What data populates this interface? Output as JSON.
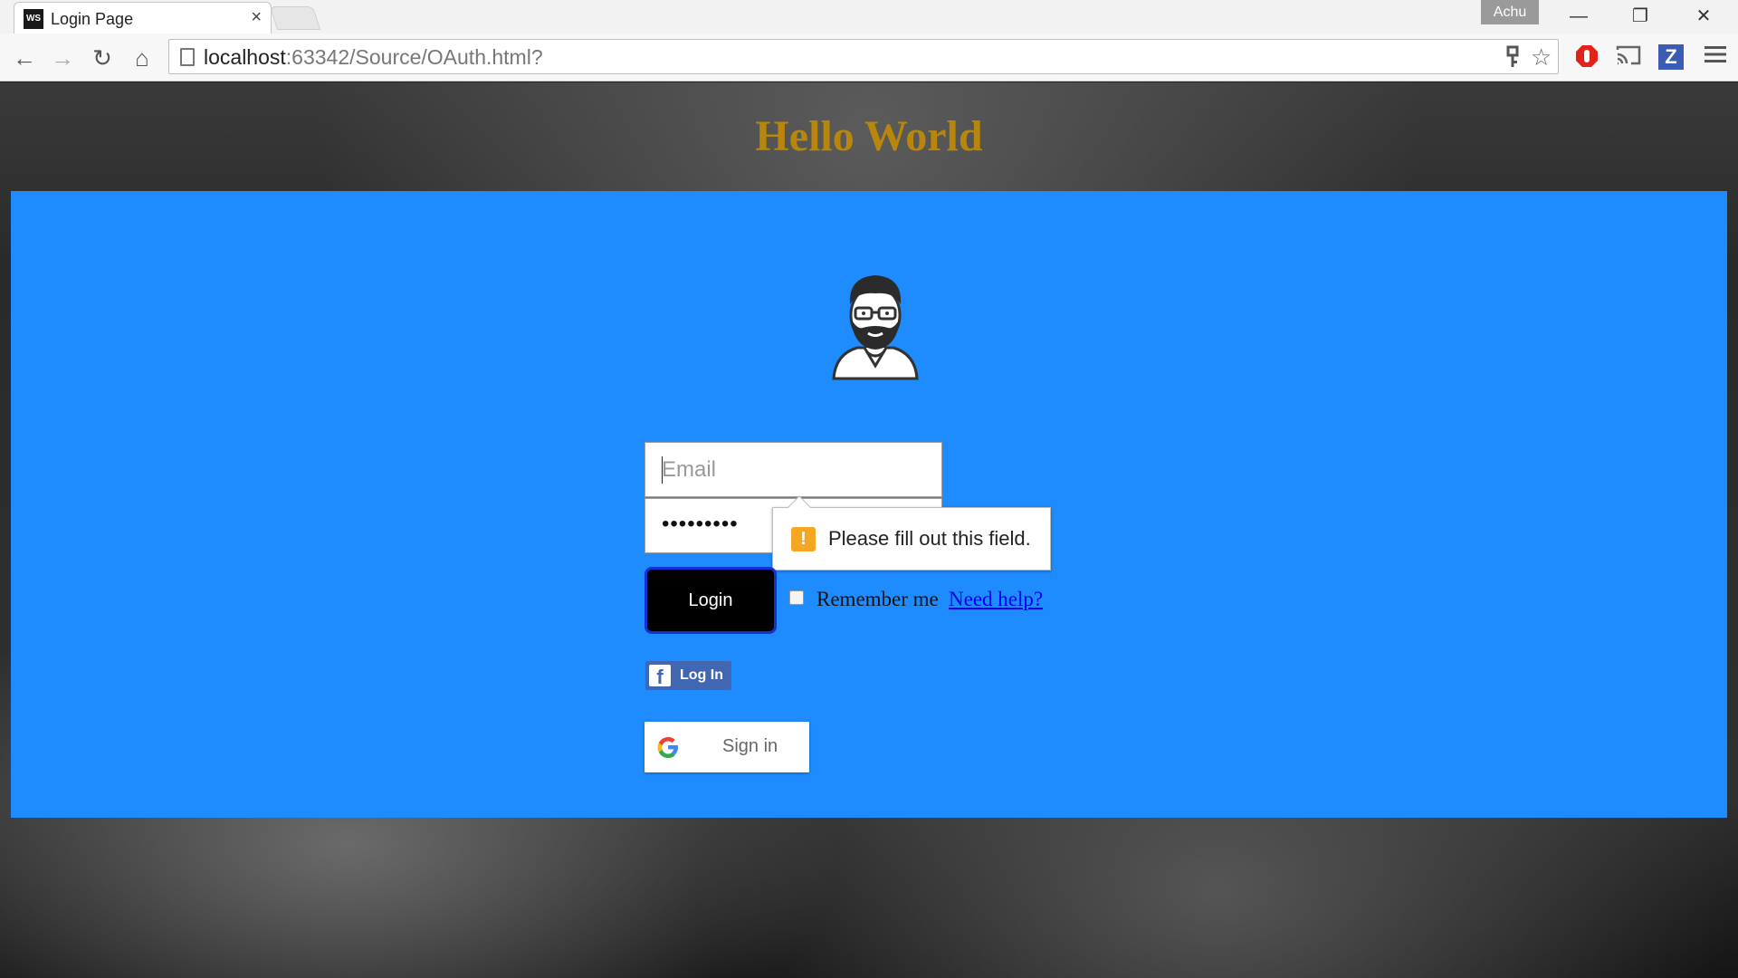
{
  "browser": {
    "tab_title": "Login Page",
    "tab_favicon_text": "WS",
    "tab_close": "×",
    "profile_name": "Achu",
    "url_host": "localhost",
    "url_rest": ":63342/Source/OAuth.html?",
    "nav": {
      "back": "←",
      "forward": "→",
      "reload": "↻",
      "home": "⌂"
    },
    "window_controls": {
      "minimize": "—",
      "restore": "❐",
      "close": "✕"
    }
  },
  "page": {
    "heading": "Hello World",
    "heading_color": "#b8860b",
    "panel_color": "#1e8cff",
    "form": {
      "email_placeholder": "Email",
      "password_mask": "•••••••••",
      "validation_message": "Please fill out this field.",
      "login_label": "Login",
      "remember_label": "Remember me",
      "remember_checked": false,
      "help_link": "Need help?"
    },
    "social": {
      "facebook_label": "Log In",
      "google_label": "Sign in"
    }
  },
  "icons": {
    "avatar": "bearded-man-with-glasses-icon",
    "warning": "warning-icon",
    "facebook": "facebook-icon",
    "google": "google-icon"
  }
}
